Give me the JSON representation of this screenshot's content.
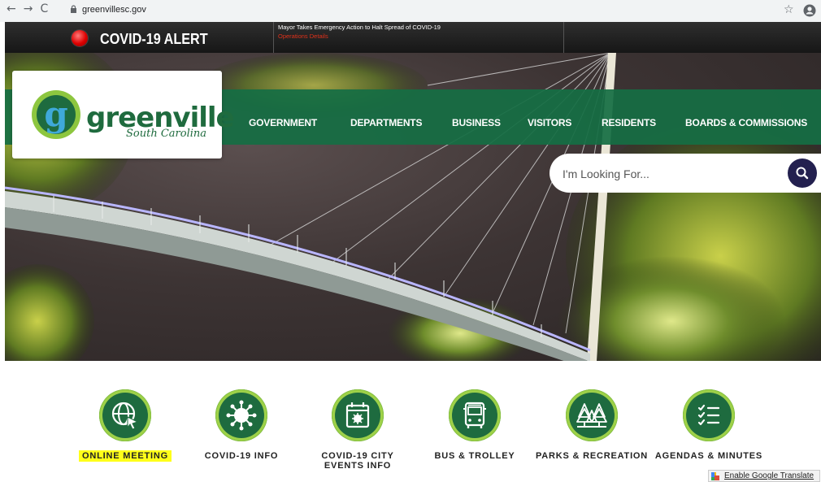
{
  "browser": {
    "url": "greenvillesc.gov",
    "back_glyph": "←",
    "forward_glyph": "→",
    "reload_glyph": "C",
    "star_glyph": "☆"
  },
  "alert": {
    "title": "COVID-19 ALERT",
    "headline": "Mayor Takes Emergency Action to Halt Spread of COVID-19",
    "link": "Operations Details"
  },
  "logo": {
    "word": "greenville",
    "script": "South Carolina",
    "letter": "g"
  },
  "nav": {
    "items": [
      "GOVERNMENT",
      "DEPARTMENTS",
      "BUSINESS",
      "VISITORS",
      "RESIDENTS",
      "BOARDS & COMMISSIONS"
    ]
  },
  "search": {
    "placeholder": "I'm Looking For..."
  },
  "quicklinks": [
    {
      "label": "ONLINE MEETING",
      "icon": "globe-cursor-icon",
      "highlighted": true
    },
    {
      "label": "COVID-19 INFO",
      "icon": "virus-icon",
      "highlighted": false
    },
    {
      "label": "COVID-19 CITY EVENTS INFO",
      "icon": "calendar-virus-icon",
      "highlighted": false
    },
    {
      "label": "BUS & TROLLEY",
      "icon": "bus-icon",
      "highlighted": false
    },
    {
      "label": "PARKS & RECREATION",
      "icon": "trees-icon",
      "highlighted": false
    },
    {
      "label": "AGENDAS & MINUTES",
      "icon": "checklist-icon",
      "highlighted": false
    }
  ],
  "translate": {
    "label": "Enable Google Translate"
  },
  "colors": {
    "brand_green": "#1e6b3f",
    "nav_green": "#166e44",
    "accent_lime": "#9ed149",
    "search_button": "#23204f",
    "alert_red": "#e0311a",
    "highlight": "#ffff1a"
  }
}
